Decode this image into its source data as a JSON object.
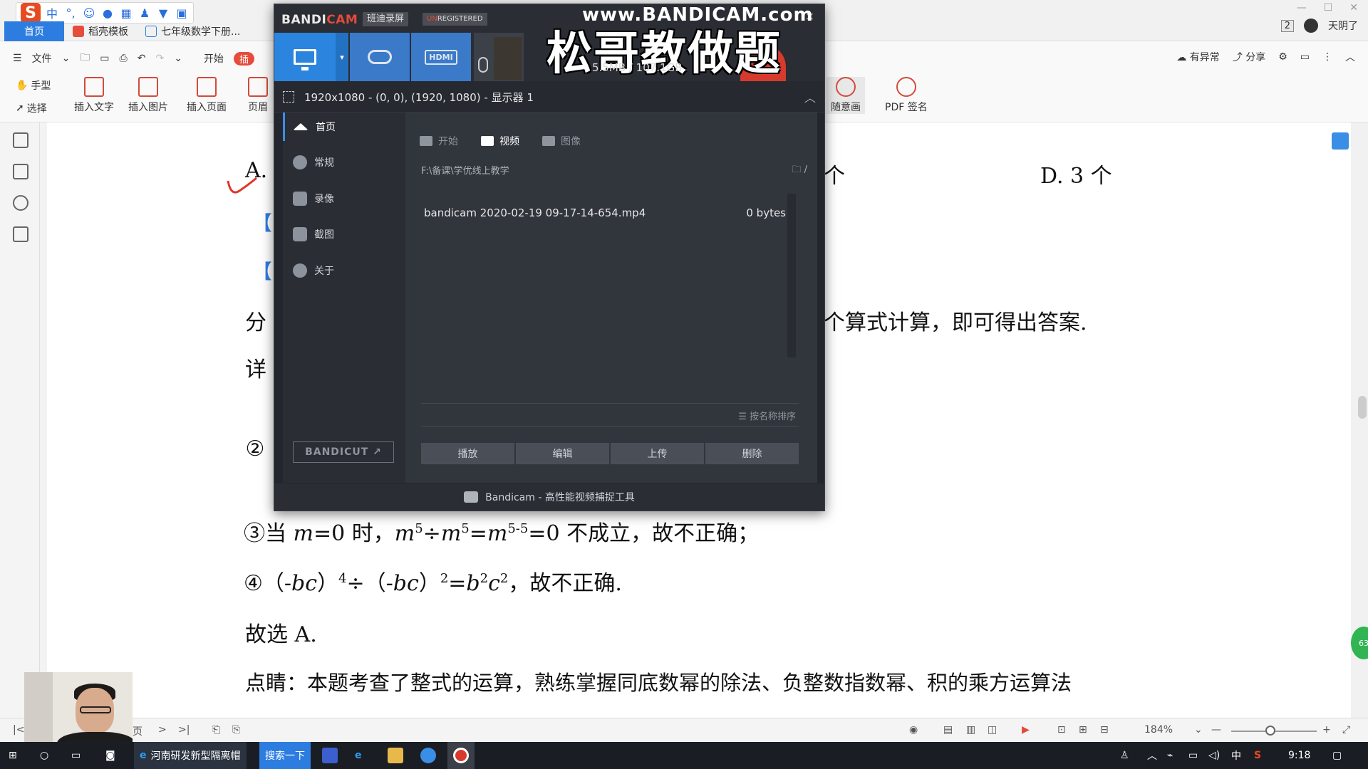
{
  "wps": {
    "tabs": [
      {
        "label": "首页"
      },
      {
        "label": "稻壳模板"
      },
      {
        "label": "七年级数学下册..."
      }
    ],
    "window_right": {
      "page_count": "2",
      "weather": "天阴了"
    },
    "menu": {
      "file": "文件",
      "start": "开始",
      "special": "插"
    },
    "menu_right": {
      "issue": "有异常",
      "share": "分享"
    },
    "toolbar": {
      "hand": "手型",
      "select": "选择",
      "insert_text": "插入文字",
      "insert_image": "插入图片",
      "insert_page": "插入页面",
      "header": "页眉",
      "draw": "随意画",
      "pdf_sign": "PDF 签名"
    },
    "status": {
      "zoom": "184%",
      "page_label": "页"
    }
  },
  "document": {
    "line_a_left": "A.",
    "line_a_right_frag": "个",
    "option_d": "D. 3 个",
    "bracket1": "【",
    "bracket2": "【",
    "analysis_left": "分",
    "analysis_right": "个算式计算，即可得出答案.",
    "detail_left": "详",
    "item2": "②",
    "item3_circle": "③",
    "item3_pre": "当 ",
    "item3_m": "m",
    "item3_eq0": "=0 时，",
    "item3_m1": "m",
    "item3_exp1": "5",
    "item3_div": "÷",
    "item3_m2": "m",
    "item3_exp2": "5",
    "item3_eq": "=",
    "item3_m3": "m",
    "item3_exp3": "5-5",
    "item3_rest": "=0 不成立，故不正确；",
    "item4_circle": "④",
    "item4_text_a": "（-",
    "item4_bc1": "bc",
    "item4_text_b": "）",
    "item4_exp1": "4",
    "item4_text_c": "÷（-",
    "item4_bc2": "bc",
    "item4_text_d": "）",
    "item4_exp2": "2",
    "item4_text_e": "=",
    "item4_b": "b",
    "item4_exp3": "2",
    "item4_c": "c",
    "item4_exp4": "2",
    "item4_text_f": "，故不正确.",
    "conclusion": "故选 A.",
    "comment": "点睛：本题考查了整式的运算，熟练掌握同底数幂的除法、负整数指数幂、积的乘方运算法"
  },
  "green_badge": "63",
  "bandicam": {
    "logo_main": "BANDI",
    "logo_accent": "CAM",
    "tag_capture": "班迪录屏",
    "tag_unreg_accent": "UN",
    "tag_unreg_rest": "REGISTERED",
    "size_text": "5.5MB / 107.1GB",
    "watermark_url": "www.BANDICAM.com",
    "watermark_text": "松哥教做题",
    "hdmi_label": "HDMI",
    "info_text": "1920x1080 - (0, 0), (1920, 1080) - 显示器 1",
    "nav": [
      {
        "label": "首页"
      },
      {
        "label": "常规"
      },
      {
        "label": "录像"
      },
      {
        "label": "截图"
      },
      {
        "label": "关于"
      }
    ],
    "bandicut": "BANDICUT ↗",
    "subtabs": [
      {
        "label": "开始"
      },
      {
        "label": "视频"
      },
      {
        "label": "图像"
      }
    ],
    "path": "F:\\备课\\学优线上教学",
    "path_sep": "/",
    "files": [
      {
        "name": "bandicam 2020-02-19 09-17-14-654.mp4",
        "size": "0 bytes"
      }
    ],
    "sort_label": "按名称排序",
    "actions": [
      "播放",
      "编辑",
      "上传",
      "删除"
    ],
    "footer": "Bandicam - 高性能视频捕捉工具"
  },
  "taskbar": {
    "app1": "河南研发新型隔离帽",
    "search": "搜索一下",
    "ime": "中",
    "time": "9:18"
  }
}
